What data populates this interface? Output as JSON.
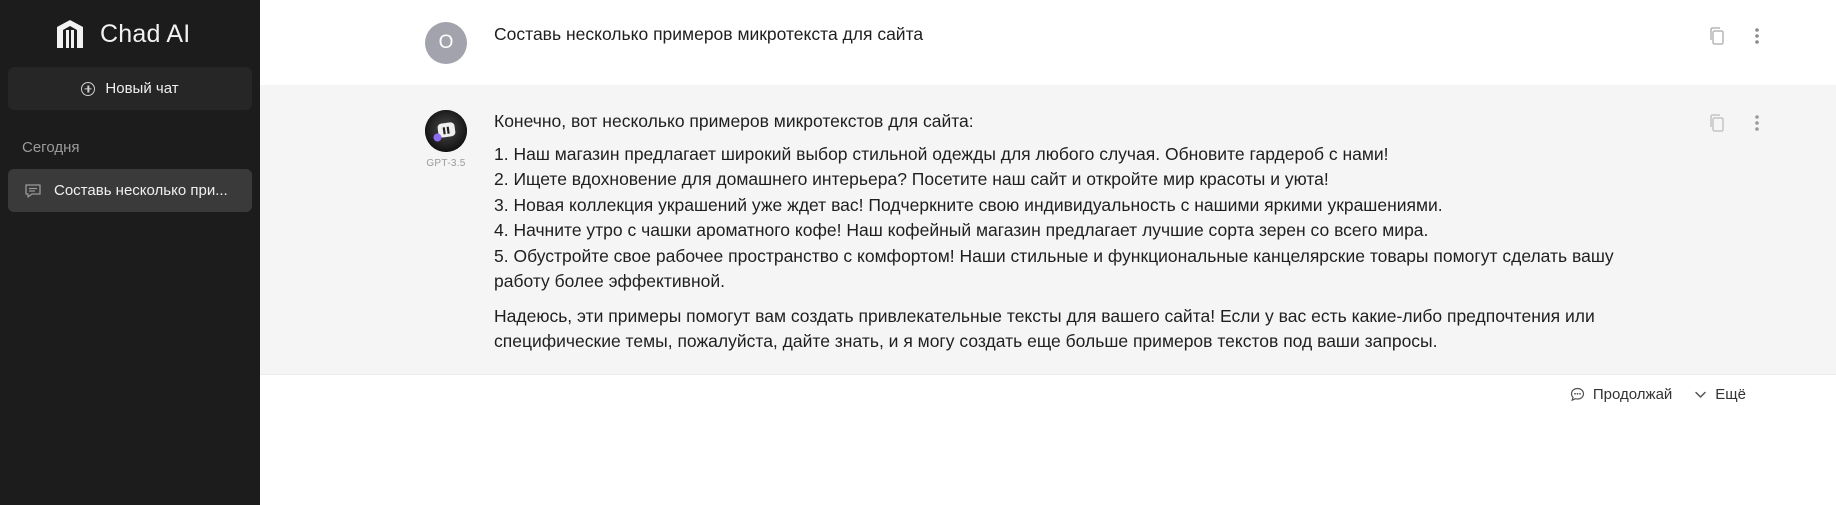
{
  "sidebar": {
    "brand": "Chad AI",
    "new_chat_label": "Новый чат",
    "section_label": "Сегодня",
    "chats": [
      {
        "label": "Составь несколько при..."
      }
    ]
  },
  "conversation": {
    "user_message": {
      "avatar_letter": "О",
      "text": "Составь несколько примеров микротекста для сайта"
    },
    "assistant_message": {
      "model": "GPT-3.5",
      "intro": "Конечно, вот несколько примеров микротекстов для сайта:",
      "items": [
        "1. Наш магазин предлагает широкий выбор стильной одежды для любого случая. Обновите гардероб с нами!",
        "2. Ищете вдохновение для домашнего интерьера? Посетите наш сайт и откройте мир красоты и уюта!",
        "3. Новая коллекция украшений уже ждет вас! Подчеркните свою индивидуальность с нашими яркими украшениями.",
        "4. Начните утро с чашки ароматного кофе! Наш кофейный магазин предлагает лучшие сорта зерен со всего мира.",
        "5. Обустройте свое рабочее пространство с комфортом! Наши стильные и функциональные канцелярские товары помогут сделать вашу работу более эффективной."
      ],
      "outro": "Надеюсь, эти примеры помогут вам создать привлекательные тексты для вашего сайта! Если у вас есть какие-либо предпочтения или специфические темы, пожалуйста, дайте знать, и я могу создать еще больше примеров текстов под ваши запросы."
    }
  },
  "footer": {
    "continue_label": "Продолжай",
    "more_label": "Ещё"
  }
}
